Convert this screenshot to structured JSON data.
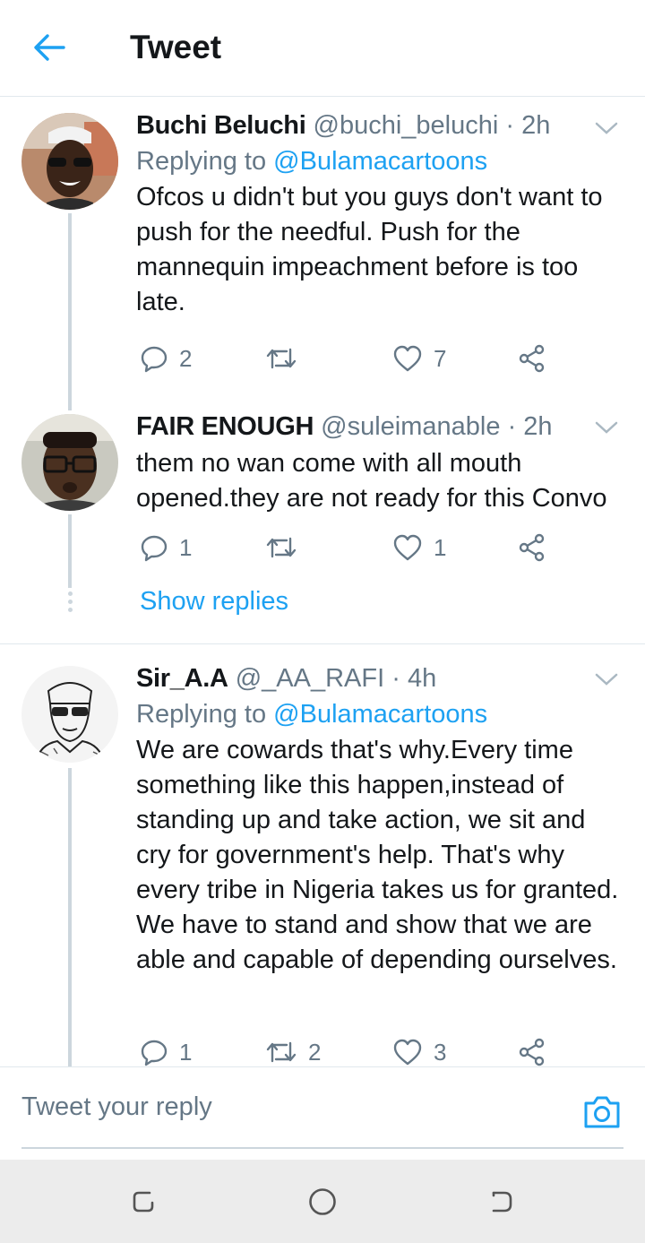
{
  "header": {
    "title": "Tweet",
    "back_icon": "arrow-left-icon"
  },
  "colors": {
    "accent": "#1da1f2",
    "text": "#14171a",
    "muted": "#657786",
    "line": "#ccd6dd",
    "navbar": "#ececec"
  },
  "tweets": [
    {
      "name": "Buchi Beluchi",
      "handle": "@buchi_beluchi",
      "time": "· 2h",
      "replying_prefix": "Replying to",
      "replying_to": "@Bulamacartoons",
      "text": "Ofcos u didn't but you guys don't want to push for the needful. Push for the mannequin impeachment before is too late.",
      "replies": "2",
      "retweets": "",
      "likes": "7"
    },
    {
      "name": "FAIR ENOUGH",
      "handle": "@suleimanable",
      "time": "· 2h",
      "text": "them no wan come with all mouth opened.they are not ready for this Convo",
      "replies": "1",
      "retweets": "",
      "likes": "1"
    },
    {
      "name": "Sir_A.A",
      "handle": "@_AA_RAFI",
      "time": "· 4h",
      "replying_prefix": "Replying to",
      "replying_to": "@Bulamacartoons",
      "text": "We are cowards that's why.Every time something like this happen,instead of standing up and take action, we sit and cry  for government's help. That's why every tribe in Nigeria takes us for granted. We have to stand and show that we are able and capable of depending ourselves.",
      "replies": "1",
      "retweets": "2",
      "likes": "3"
    }
  ],
  "show_replies": "Show replies",
  "reply_bar": {
    "placeholder": "Tweet your reply",
    "camera_icon": "camera-icon"
  },
  "navbar": {
    "icons": [
      "recent-apps-icon",
      "home-icon",
      "back-icon"
    ]
  }
}
